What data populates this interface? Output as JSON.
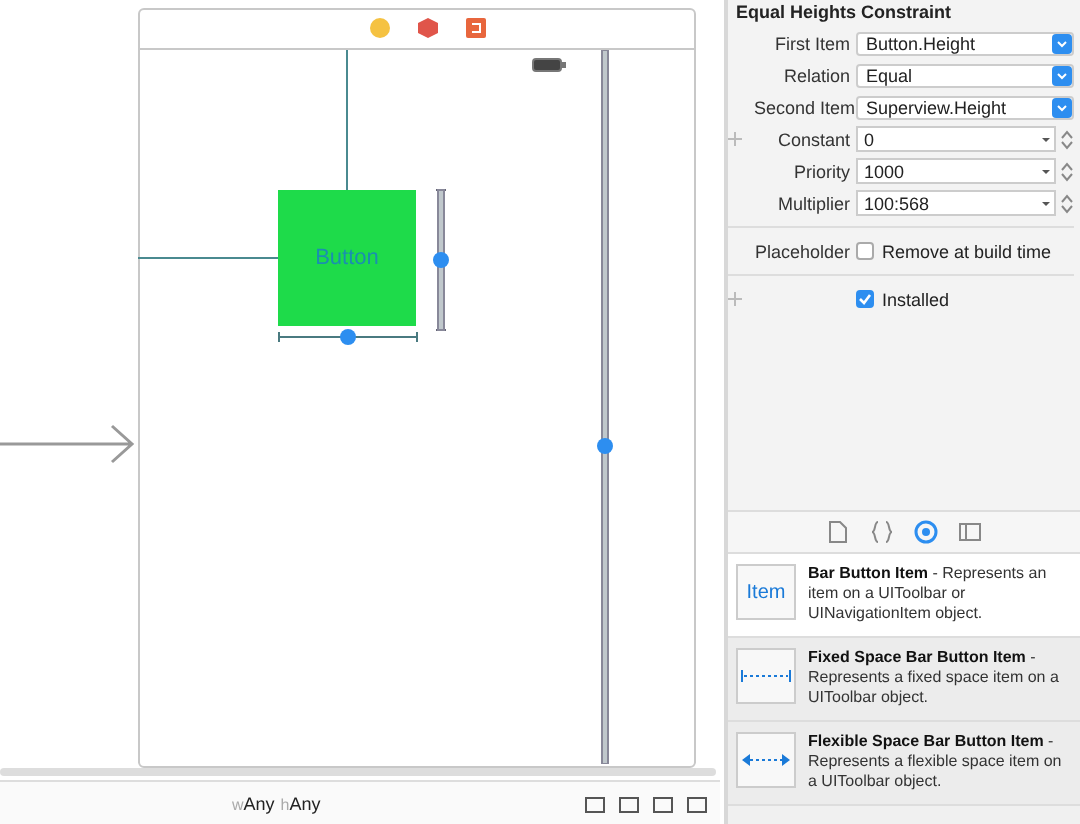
{
  "scene": {
    "button": {
      "label": "Button"
    }
  },
  "size_class": [
    {
      "prefix": "w",
      "value": "Any"
    },
    {
      "prefix": "h",
      "value": "Any"
    }
  ],
  "inspector": {
    "title": "Equal Heights Constraint",
    "fields": [
      {
        "kind": "popup",
        "label": "First Item",
        "value": "Button.Height"
      },
      {
        "kind": "popup",
        "label": "Relation",
        "value": "Equal"
      },
      {
        "kind": "popup",
        "label": "Second Item",
        "value": "Superview.Height"
      },
      {
        "kind": "combo",
        "label": "Constant",
        "value": "0"
      },
      {
        "kind": "combo",
        "label": "Priority",
        "value": "1000"
      },
      {
        "kind": "combo",
        "label": "Multiplier",
        "value": "100:568"
      },
      {
        "kind": "checkbox",
        "label": "Placeholder",
        "text": "Remove at build time",
        "checked": false
      },
      {
        "kind": "checkbox",
        "text": "Installed",
        "checked": true
      }
    ]
  },
  "library_tabs": [
    {
      "kind": "file",
      "selected": false
    },
    {
      "kind": "braces",
      "selected": false
    },
    {
      "kind": "circle",
      "selected": true
    },
    {
      "kind": "grid",
      "selected": false
    }
  ],
  "library": [
    {
      "kind": "item",
      "icon_text": "Item",
      "title": "Bar Button Item",
      "description": " - Represents an item on a UIToolbar or UINavigationItem object.",
      "selected": true
    },
    {
      "kind": "fixed",
      "title": "Fixed Space Bar Button Item",
      "description": " - Represents a fixed space item on a UIToolbar object.",
      "selected": false
    },
    {
      "kind": "flexible",
      "title": "Flexible Space Bar Button Item",
      "description": " - Represents a flexible space item on a UIToolbar object.",
      "selected": false
    }
  ]
}
